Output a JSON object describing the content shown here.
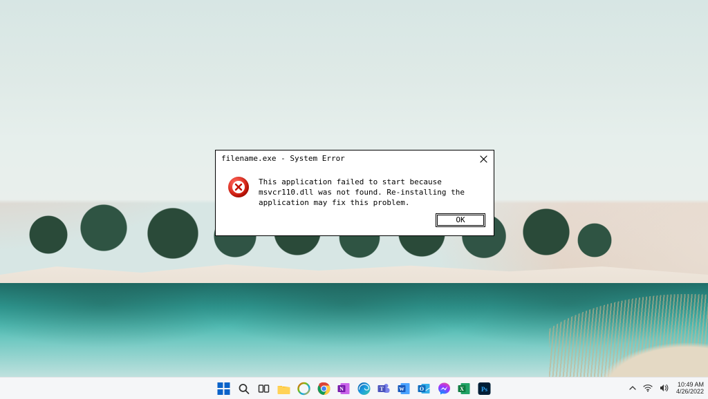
{
  "dialog": {
    "title": "filename.exe - System Error",
    "message": "This application failed to start because msvcr110.dll was not found. Re-installing the application may fix this problem.",
    "ok_label": "OK"
  },
  "taskbar": {
    "icons": [
      {
        "name": "start",
        "label": "Start"
      },
      {
        "name": "search",
        "label": "Search"
      },
      {
        "name": "task-view",
        "label": "Task View"
      },
      {
        "name": "file-explorer",
        "label": "File Explorer"
      },
      {
        "name": "chat",
        "label": "Chat"
      },
      {
        "name": "chrome",
        "label": "Google Chrome"
      },
      {
        "name": "onenote",
        "label": "OneNote"
      },
      {
        "name": "edge",
        "label": "Microsoft Edge"
      },
      {
        "name": "teams",
        "label": "Microsoft Teams"
      },
      {
        "name": "word",
        "label": "Microsoft Word"
      },
      {
        "name": "outlook",
        "label": "Outlook"
      },
      {
        "name": "messenger",
        "label": "Messenger"
      },
      {
        "name": "excel",
        "label": "Microsoft Excel"
      },
      {
        "name": "photoshop",
        "label": "Adobe Photoshop"
      }
    ]
  },
  "systray": {
    "time": "10:49 AM",
    "date": "4/26/2022"
  }
}
